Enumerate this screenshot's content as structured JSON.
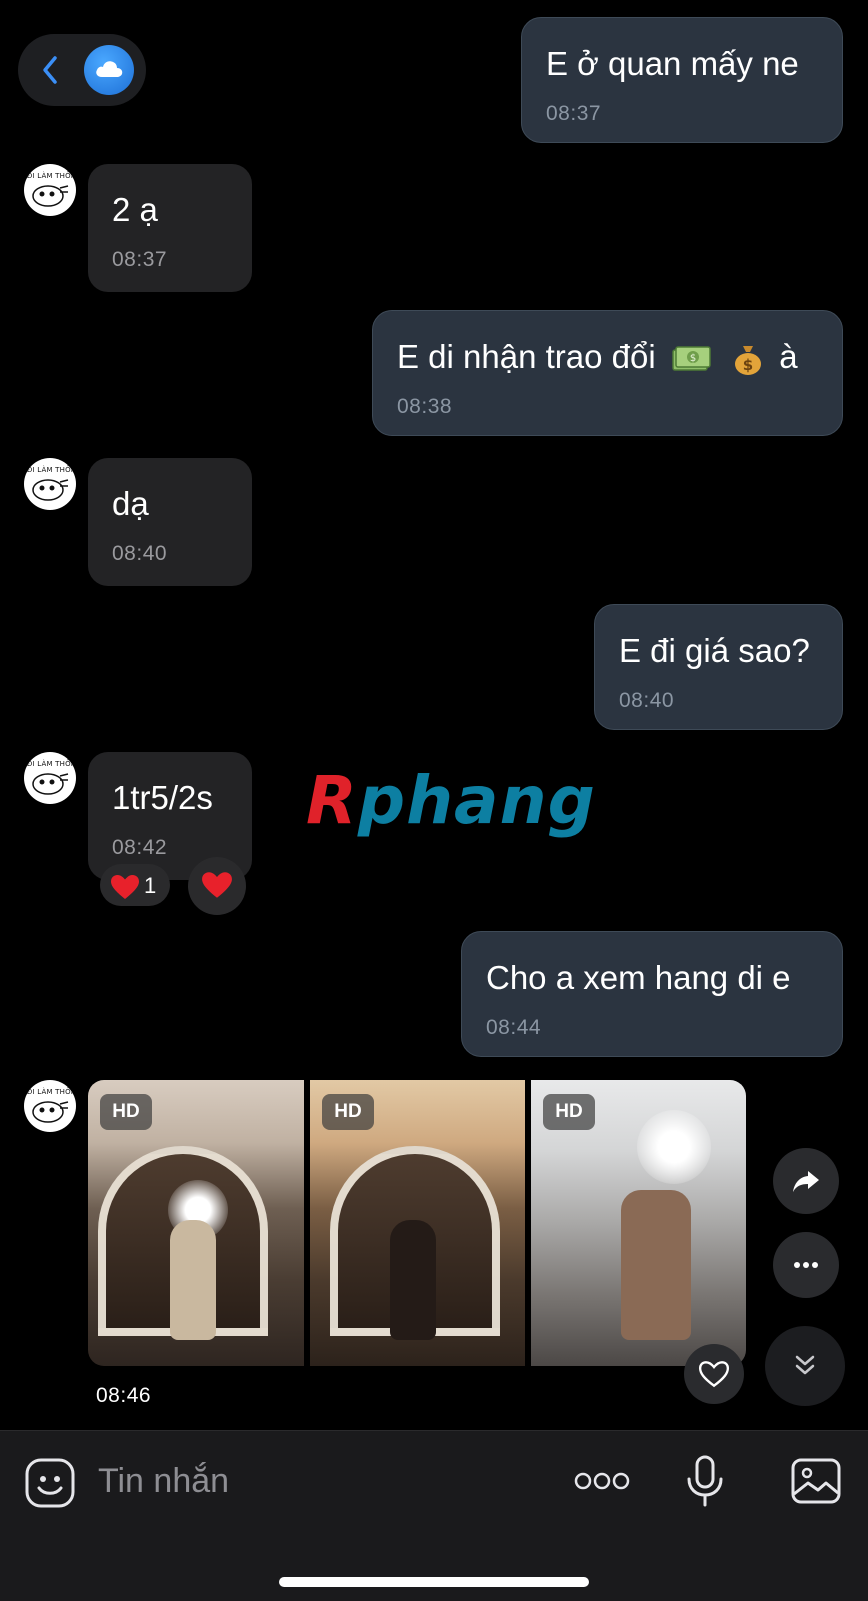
{
  "header": {
    "back_icon": "chevron-left-icon",
    "contact_avatar_icon": "cloud-icon",
    "accent_color": "#1e88f5"
  },
  "contact": {
    "avatar_text": "ĐI LÀM THÔI"
  },
  "messages": [
    {
      "direction": "out",
      "text": "E ở quan mấy ne",
      "time": "08:37"
    },
    {
      "direction": "in",
      "text": "2 ạ",
      "time": "08:37"
    },
    {
      "direction": "out",
      "text_before": "E di nhận trao đổi",
      "emojis": [
        "money-bills-emoji",
        "money-bag-emoji"
      ],
      "text_after": "à",
      "time": "08:38"
    },
    {
      "direction": "in",
      "text": "dạ",
      "time": "08:40"
    },
    {
      "direction": "out",
      "text": "E đi giá sao?",
      "time": "08:40"
    },
    {
      "direction": "in",
      "text": "1tr5/2s",
      "time": "08:42",
      "reaction": {
        "emoji": "heart",
        "count": "1"
      }
    },
    {
      "direction": "out",
      "text": "Cho a xem hang di e",
      "time": "08:44"
    }
  ],
  "watermark": {
    "first": "R",
    "rest": "phang"
  },
  "photo_message": {
    "badges": [
      "HD",
      "HD",
      "HD"
    ],
    "time": "08:46",
    "actions": [
      "share-icon",
      "more-icon",
      "scroll-down-icon",
      "heart-outline-icon"
    ]
  },
  "composer": {
    "placeholder": "Tin nhắn",
    "value": "",
    "icons": [
      "sticker-icon",
      "more-options-icon",
      "microphone-icon",
      "image-icon"
    ]
  },
  "colors": {
    "background": "#000000",
    "outgoing_bubble": "#2b3440",
    "incoming_bubble": "#232325",
    "reaction_heart": "#e8212b"
  }
}
